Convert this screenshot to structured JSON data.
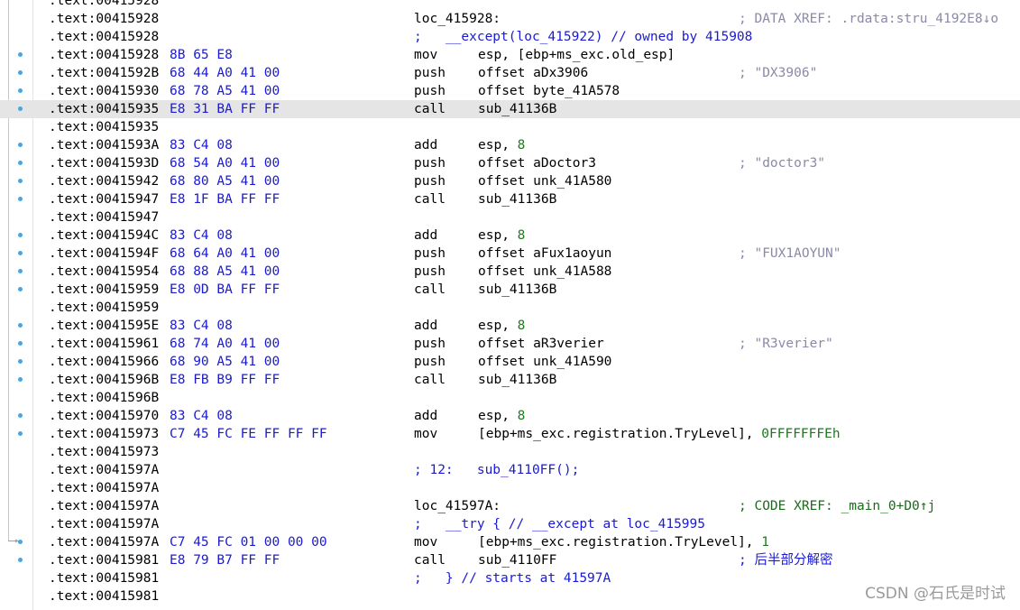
{
  "watermark": "CSDN @石氏是时试",
  "rows": [
    {
      "addr": ".text:00415928",
      "dot": false,
      "kind": "blank"
    },
    {
      "addr": ".text:00415928",
      "dot": false,
      "kind": "label",
      "label": "loc_415928:",
      "xref": "; DATA XREF: .rdata:stru_4192E8↓o"
    },
    {
      "addr": ".text:00415928",
      "dot": false,
      "kind": "scmt",
      "text": ";   __except(loc_415922) // owned by 415908"
    },
    {
      "addr": ".text:00415928",
      "bytes": "8B 65 E8",
      "dot": true,
      "mnem": "mov",
      "ops": "esp, [ebp+ms_exc.old_esp]"
    },
    {
      "addr": ".text:0041592B",
      "bytes": "68 44 A0 41 00",
      "dot": true,
      "mnem": "push",
      "ops": "offset aDx3906",
      "cmt": "; \"DX3906\""
    },
    {
      "addr": ".text:00415930",
      "bytes": "68 78 A5 41 00",
      "dot": true,
      "mnem": "push",
      "ops": "offset byte_41A578"
    },
    {
      "addr": ".text:00415935",
      "bytes": "E8 31 BA FF FF",
      "dot": true,
      "mnem": "call",
      "ops": "sub_41136B",
      "hl": true
    },
    {
      "addr": ".text:00415935",
      "dot": false,
      "kind": "blank"
    },
    {
      "addr": ".text:0041593A",
      "bytes": "83 C4 08",
      "dot": true,
      "mnem": "add",
      "ops": "esp, ",
      "num": "8"
    },
    {
      "addr": ".text:0041593D",
      "bytes": "68 54 A0 41 00",
      "dot": true,
      "mnem": "push",
      "ops": "offset aDoctor3",
      "cmt": "; \"doctor3\""
    },
    {
      "addr": ".text:00415942",
      "bytes": "68 80 A5 41 00",
      "dot": true,
      "mnem": "push",
      "ops": "offset unk_41A580"
    },
    {
      "addr": ".text:00415947",
      "bytes": "E8 1F BA FF FF",
      "dot": true,
      "mnem": "call",
      "ops": "sub_41136B"
    },
    {
      "addr": ".text:00415947",
      "dot": false,
      "kind": "blank"
    },
    {
      "addr": ".text:0041594C",
      "bytes": "83 C4 08",
      "dot": true,
      "mnem": "add",
      "ops": "esp, ",
      "num": "8"
    },
    {
      "addr": ".text:0041594F",
      "bytes": "68 64 A0 41 00",
      "dot": true,
      "mnem": "push",
      "ops": "offset aFux1aoyun",
      "cmt": "; \"FUX1AOYUN\""
    },
    {
      "addr": ".text:00415954",
      "bytes": "68 88 A5 41 00",
      "dot": true,
      "mnem": "push",
      "ops": "offset unk_41A588"
    },
    {
      "addr": ".text:00415959",
      "bytes": "E8 0D BA FF FF",
      "dot": true,
      "mnem": "call",
      "ops": "sub_41136B"
    },
    {
      "addr": ".text:00415959",
      "dot": false,
      "kind": "blank"
    },
    {
      "addr": ".text:0041595E",
      "bytes": "83 C4 08",
      "dot": true,
      "mnem": "add",
      "ops": "esp, ",
      "num": "8"
    },
    {
      "addr": ".text:00415961",
      "bytes": "68 74 A0 41 00",
      "dot": true,
      "mnem": "push",
      "ops": "offset aR3verier",
      "cmt": "; \"R3verier\""
    },
    {
      "addr": ".text:00415966",
      "bytes": "68 90 A5 41 00",
      "dot": true,
      "mnem": "push",
      "ops": "offset unk_41A590"
    },
    {
      "addr": ".text:0041596B",
      "bytes": "E8 FB B9 FF FF",
      "dot": true,
      "mnem": "call",
      "ops": "sub_41136B"
    },
    {
      "addr": ".text:0041596B",
      "dot": false,
      "kind": "blank"
    },
    {
      "addr": ".text:00415970",
      "bytes": "83 C4 08",
      "dot": true,
      "mnem": "add",
      "ops": "esp, ",
      "num": "8"
    },
    {
      "addr": ".text:00415973",
      "bytes": "C7 45 FC FE FF FF FF",
      "dot": true,
      "mnem": "mov",
      "ops": "[ebp+ms_exc.registration.TryLevel], ",
      "num": "0FFFFFFFEh"
    },
    {
      "addr": ".text:00415973",
      "dot": false,
      "kind": "blank"
    },
    {
      "addr": ".text:0041597A",
      "dot": false,
      "kind": "scmt",
      "text": "; 12:   sub_4110FF();"
    },
    {
      "addr": ".text:0041597A",
      "dot": false,
      "kind": "blank"
    },
    {
      "addr": ".text:0041597A",
      "dot": false,
      "kind": "label",
      "label": "loc_41597A:",
      "xref": "; CODE XREF: _main_0+D0↑j",
      "code": true
    },
    {
      "addr": ".text:0041597A",
      "dot": false,
      "kind": "scmt",
      "text": ";   __try { // __except at loc_415995"
    },
    {
      "addr": ".text:0041597A",
      "bytes": "C7 45 FC 01 00 00 00",
      "dot": true,
      "mnem": "mov",
      "ops": "[ebp+ms_exc.registration.TryLevel], ",
      "num": "1"
    },
    {
      "addr": ".text:00415981",
      "bytes": "E8 79 B7 FF FF",
      "dot": true,
      "mnem": "call",
      "ops": "sub_4110FF",
      "cmt": "; 后半部分解密",
      "cn": true
    },
    {
      "addr": ".text:00415981",
      "dot": false,
      "kind": "scmt",
      "text": ";   } // starts at 41597A"
    },
    {
      "addr": ".text:00415981",
      "dot": false,
      "kind": "blank"
    }
  ]
}
